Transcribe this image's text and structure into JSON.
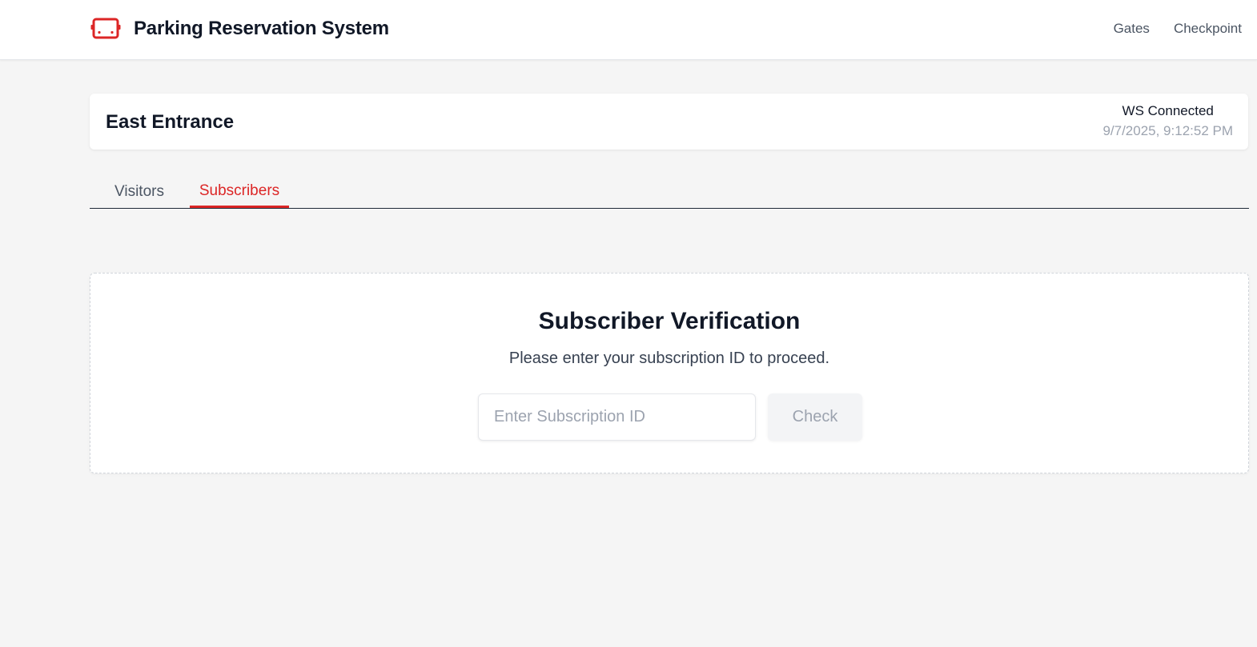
{
  "header": {
    "icon": "bus-icon",
    "title": "Parking Reservation System",
    "nav": [
      {
        "label": "Gates"
      },
      {
        "label": "Checkpoint"
      }
    ]
  },
  "gate": {
    "name": "East Entrance",
    "ws_status": "WS Connected",
    "timestamp": "9/7/2025, 9:12:52 PM"
  },
  "tabs": [
    {
      "label": "Visitors",
      "active": false
    },
    {
      "label": "Subscribers",
      "active": true
    }
  ],
  "verification": {
    "title": "Subscriber Verification",
    "description": "Please enter your subscription ID to proceed.",
    "input_placeholder": "Enter Subscription ID",
    "input_value": "",
    "button_label": "Check"
  },
  "colors": {
    "accent": "#dc2626",
    "background": "#f5f5f5",
    "muted_text": "#9ca3af"
  }
}
